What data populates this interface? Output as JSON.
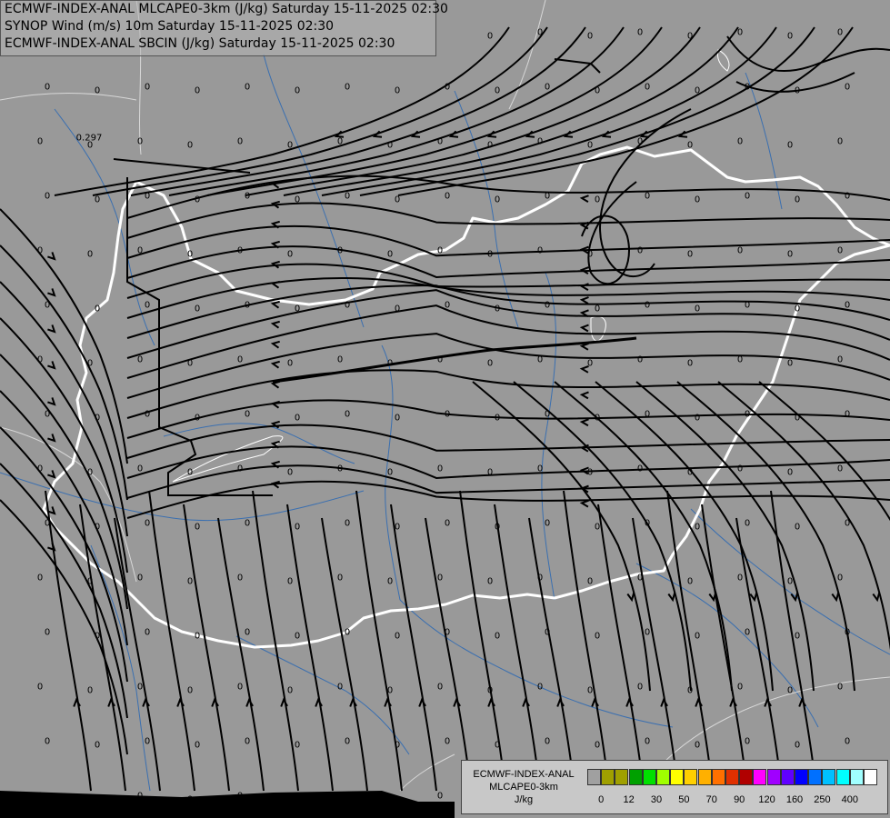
{
  "header": {
    "line1": "ECMWF-INDEX-ANAL MLCAPE0-3km (J/kg) Saturday 15-11-2025 02:30",
    "line2": "SYNOP Wind (m/s) 10m Saturday 15-11-2025 02:30",
    "line3": "ECMWF-INDEX-ANAL SBCIN (J/kg) Saturday 15-11-2025 02:30"
  },
  "legend": {
    "line1": "ECMWF-INDEX-ANAL",
    "line2": "MLCAPE0-3km",
    "line3": "J/kg",
    "colors": [
      "#a0a0a0",
      "#a0a000",
      "#a0a000",
      "#00a000",
      "#00e000",
      "#a0ff00",
      "#ffff00",
      "#ffd000",
      "#ffb000",
      "#ff7000",
      "#e03000",
      "#b00000",
      "#ff00ff",
      "#a000ff",
      "#6000ff",
      "#0000ff",
      "#0070ff",
      "#00c0ff",
      "#00ffff",
      "#a0ffff",
      "#ffffff"
    ],
    "ticks": [
      "0",
      "12",
      "30",
      "50",
      "70",
      "90",
      "120",
      "160",
      "250",
      "400"
    ]
  },
  "values": {
    "zero": "0",
    "special": "0.297"
  }
}
